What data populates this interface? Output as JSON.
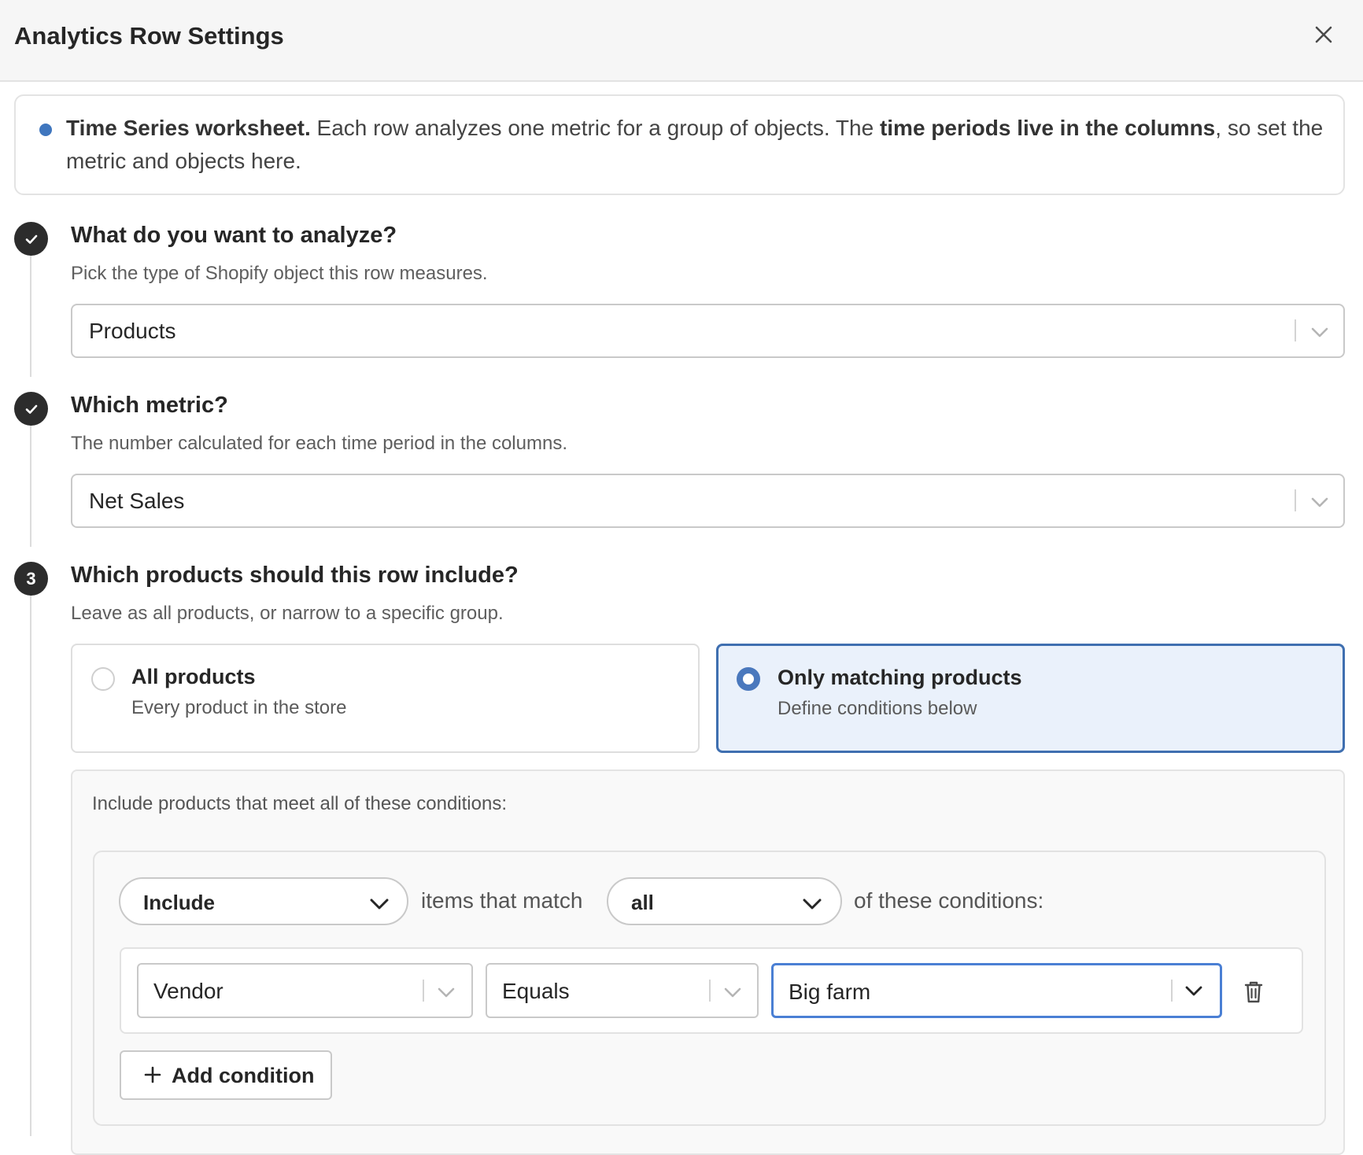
{
  "header": {
    "title": "Analytics Row Settings",
    "close_icon": "close-icon"
  },
  "info": {
    "bold_lead": "Time Series worksheet.",
    "text_1": " Each row analyzes one metric for a group of objects. The ",
    "bold_mid": "time periods live in the columns",
    "text_2": ", so set the metric and objects here."
  },
  "steps": [
    {
      "badge": "check",
      "title": "What do you want to analyze?",
      "description": "Pick the type of Shopify object this row measures.",
      "select_value": "Products"
    },
    {
      "badge": "check",
      "title": "Which metric?",
      "description": "The number calculated for each time period in the columns.",
      "select_value": "Net Sales"
    },
    {
      "badge": "3",
      "title": "Which products should this row include?",
      "description": "Leave as all products, or narrow to a specific group."
    }
  ],
  "scope_options": [
    {
      "label": "All products",
      "sublabel": "Every product in the store",
      "selected": false
    },
    {
      "label": "Only matching products",
      "sublabel": "Define conditions below",
      "selected": true
    }
  ],
  "conditions": {
    "intro": "Include products that meet all of these conditions:",
    "mode_value": "Include",
    "text_between": "items that match",
    "match_value": "all",
    "text_after": "of these conditions:",
    "rows": [
      {
        "field": "Vendor",
        "operator": "Equals",
        "value": "Big farm"
      }
    ],
    "add_label": "Add condition"
  },
  "colors": {
    "accent": "#3f6fb0",
    "selected_bg": "#eaf1fb",
    "badge": "#2c2c2c",
    "focus": "#4a7fd4"
  }
}
